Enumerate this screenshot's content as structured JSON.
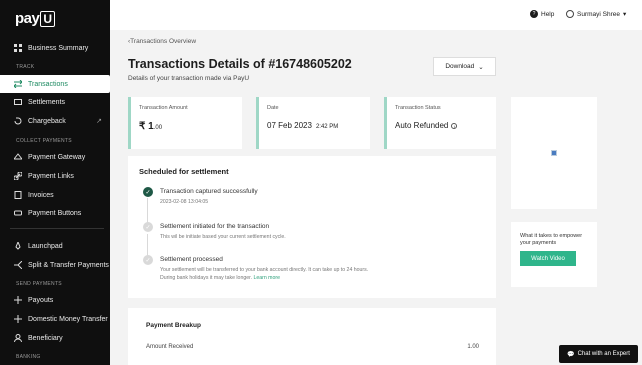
{
  "brand": {
    "logo_text": "pay",
    "logo_box": "U"
  },
  "sidebar": {
    "items": [
      {
        "label": "Business Summary",
        "icon": "grid-icon"
      },
      {
        "label": "Transactions",
        "icon": "transactions-icon",
        "active": true
      },
      {
        "label": "Settlements",
        "icon": "settlements-icon"
      },
      {
        "label": "Chargeback",
        "icon": "chargeback-icon"
      },
      {
        "label": "Payment Gateway",
        "icon": "gateway-icon"
      },
      {
        "label": "Payment Links",
        "icon": "link-icon"
      },
      {
        "label": "Invoices",
        "icon": "invoice-icon"
      },
      {
        "label": "Payment Buttons",
        "icon": "button-icon"
      },
      {
        "label": "Launchpad",
        "icon": "rocket-icon"
      },
      {
        "label": "Split & Transfer Payments",
        "icon": "split-icon"
      },
      {
        "label": "Payouts",
        "icon": "payouts-icon"
      },
      {
        "label": "Domestic Money Transfer",
        "icon": "transfer-icon"
      },
      {
        "label": "Beneficiary",
        "icon": "beneficiary-icon"
      }
    ],
    "sections": {
      "track": "TRACK",
      "collect": "COLLECT PAYMENTS",
      "send": "SEND PAYMENTS",
      "banking": "BANKING"
    }
  },
  "header": {
    "help": "Help",
    "user": "Surmayi Shree"
  },
  "main": {
    "breadcrumb": "Transactions Overview",
    "title": "Transactions Details of #16748605202",
    "subtitle": "Details of your transaction made via PayU",
    "download_label": "Download",
    "stats": {
      "amount": {
        "label": "Transaction Amount",
        "currency": "₹",
        "whole": "1",
        "decimal": ".00"
      },
      "date": {
        "label": "Date",
        "value": "07 Feb 2023",
        "time": "2:42 PM"
      },
      "status": {
        "label": "Transaction Status",
        "value": "Auto Refunded"
      }
    },
    "settlement": {
      "title": "Scheduled for settlement",
      "steps": [
        {
          "head": "Transaction captured successfully",
          "desc": "2023-02-08 13:04:05",
          "done": true
        },
        {
          "head": "Settlement initiated for the transaction",
          "desc": "This wil be initiate based your current settlement cycle.",
          "done": false
        },
        {
          "head": "Settlement processed",
          "desc": "Your settlement will be transferred to your bank account directly. It can take up to 24 hours. During bank holidays it may take longer.",
          "link": "Learn more",
          "done": false
        }
      ]
    },
    "breakup": {
      "title": "Payment Breakup",
      "row_label": "Amount Received",
      "row_value": "1.00"
    },
    "promo": {
      "text": "What it takes to empower your payments",
      "button": "Watch Video"
    },
    "chat": "Chat with an Expert"
  },
  "colors": {
    "accent": "#2fb58b",
    "sidebar_bg": "#0f0f0f",
    "step_done": "#1e5846"
  }
}
